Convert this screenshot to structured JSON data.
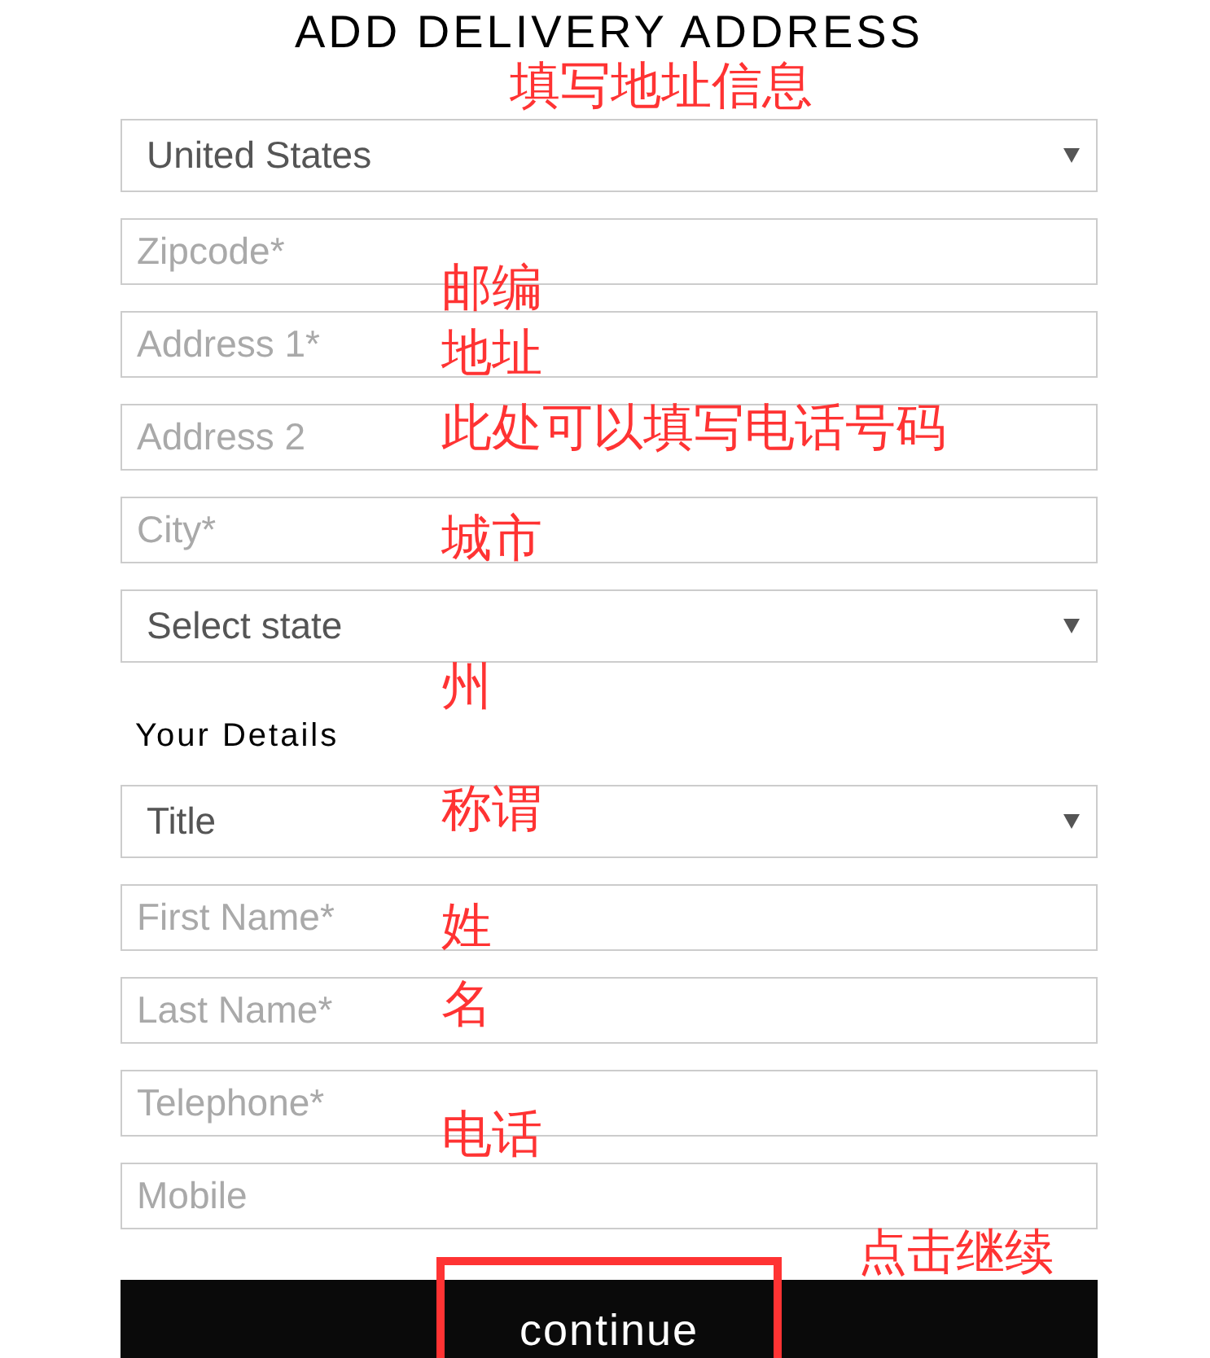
{
  "page": {
    "title": "ADD DELIVERY ADDRESS"
  },
  "address_fields": [
    {
      "kind": "select",
      "value": "United States"
    },
    {
      "kind": "input",
      "placeholder": "Zipcode*"
    },
    {
      "kind": "input",
      "placeholder": "Address 1*"
    },
    {
      "kind": "input",
      "placeholder": "Address 2"
    },
    {
      "kind": "input",
      "placeholder": "City*"
    },
    {
      "kind": "select",
      "value": "Select state"
    }
  ],
  "details_heading": "Your Details",
  "detail_fields": [
    {
      "kind": "select",
      "value": "Title"
    },
    {
      "kind": "input",
      "placeholder": "First Name*"
    },
    {
      "kind": "input",
      "placeholder": "Last Name*"
    },
    {
      "kind": "input",
      "placeholder": "Telephone*"
    },
    {
      "kind": "input",
      "placeholder": "Mobile"
    }
  ],
  "continue_button": "continue",
  "annotations": [
    {
      "kind": "text",
      "text": "填写地址信息"
    },
    {
      "kind": "text",
      "text": "邮编"
    },
    {
      "kind": "text",
      "text": "地址"
    },
    {
      "kind": "text",
      "text": "此处可以填写电话号码"
    },
    {
      "kind": "text",
      "text": "城市"
    },
    {
      "kind": "text",
      "text": "州"
    },
    {
      "kind": "text",
      "text": "称谓"
    },
    {
      "kind": "text",
      "text": "姓"
    },
    {
      "kind": "text",
      "text": "名"
    },
    {
      "kind": "text",
      "text": "电话"
    },
    {
      "kind": "text",
      "text": "点击继续"
    },
    {
      "kind": "frame"
    }
  ]
}
